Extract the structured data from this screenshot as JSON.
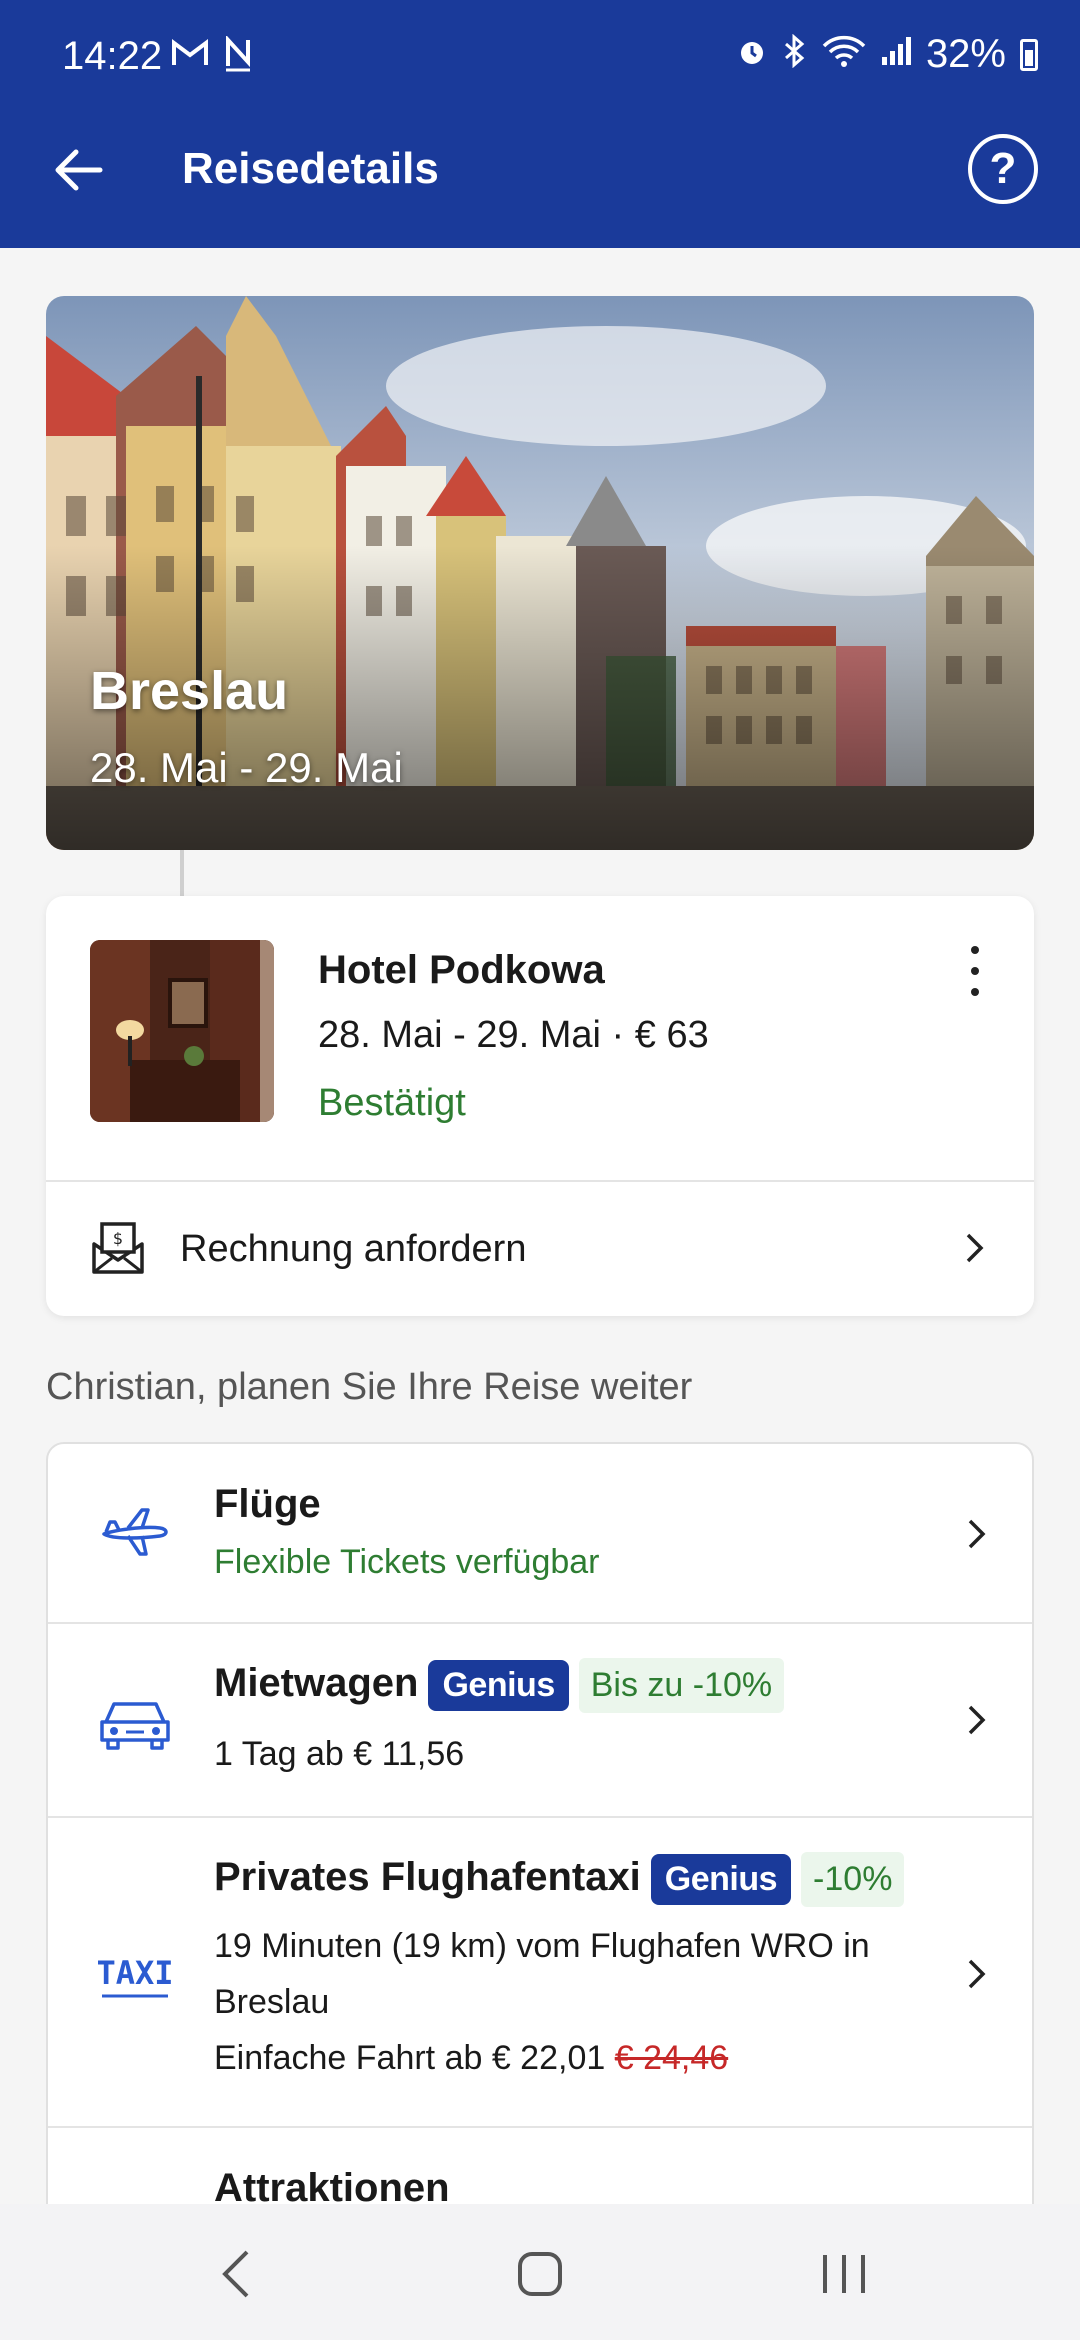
{
  "status_bar": {
    "time": "14:22",
    "left_icons": [
      "gmail-icon",
      "notification-n-icon"
    ],
    "right_icons": [
      "alarm-icon",
      "bluetooth-icon",
      "wifi-icon",
      "signal-icon"
    ],
    "battery": "32%"
  },
  "app_bar": {
    "title": "Reisedetails"
  },
  "hero": {
    "city": "Breslau",
    "dates": "28. Mai - 29. Mai"
  },
  "hotel": {
    "name": "Hotel Podkowa",
    "meta": "28. Mai - 29. Mai · € 63",
    "status": "Bestätigt",
    "invoice_label": "Rechnung anfordern"
  },
  "plan": {
    "heading": "Christian, planen Sie Ihre Reise weiter",
    "items": [
      {
        "title": "Flüge",
        "subtitle": "Flexible Tickets verfügbar",
        "icon": "plane-icon"
      },
      {
        "title": "Mietwagen",
        "badge": "Genius",
        "deal": "Bis zu -10%",
        "subtitle": "1 Tag ab € 11,56",
        "icon": "car-icon"
      },
      {
        "title": "Privates Flughafentaxi",
        "badge": "Genius",
        "deal": "-10%",
        "subtitle_line1": "19 Minuten (19 km) vom Flughafen WRO in",
        "subtitle_line2": "Breslau",
        "price_prefix": "Einfache Fahrt ab € 22,01",
        "price_old": "€ 24,46",
        "icon": "taxi-icon",
        "icon_text": "TAXI"
      },
      {
        "title": "Attraktionen"
      }
    ]
  },
  "colors": {
    "brand": "#1a3a9a",
    "confirmed_green": "#2e7d32",
    "strike_red": "#c62828"
  }
}
